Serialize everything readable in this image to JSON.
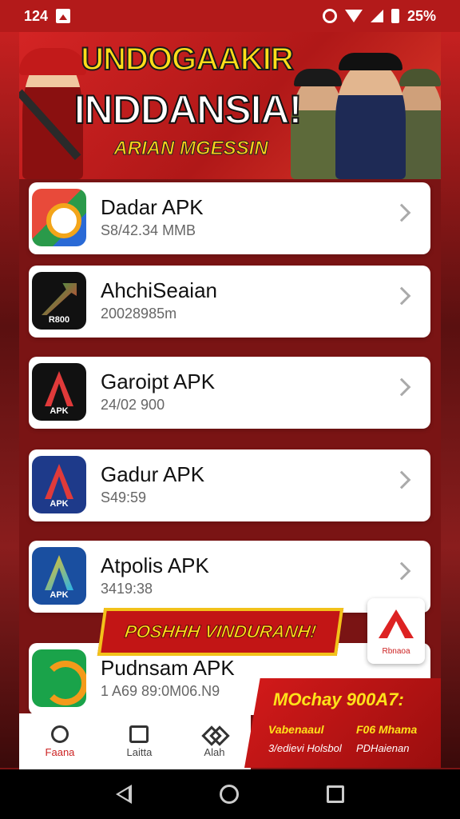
{
  "status_bar": {
    "time": "124",
    "battery": "25%"
  },
  "banner": {
    "title_line1": "UNDOGAAKIR",
    "title_line2": "INDDANSIA!",
    "subtitle": "ARIAN MGESSIN"
  },
  "apps": [
    {
      "name": "Dadar APK",
      "meta": "S8/42.34 MMB",
      "icon": "colorful-g-app-icon"
    },
    {
      "name": "AhchiSeaian",
      "meta": "20028985m",
      "icon": "red-arrow-app-icon",
      "icon_label": "R800"
    },
    {
      "name": "Garoipt APK",
      "meta": "24/02 900",
      "icon": "apk-a-black-icon",
      "icon_label": "APK"
    },
    {
      "name": "Gadur APK",
      "meta": "S49:59",
      "icon": "apk-a-blue-icon",
      "icon_label": "APK"
    },
    {
      "name": "Atpolis APK",
      "meta": "3419:38",
      "icon": "apk-a-yellow-icon",
      "icon_label": "APK"
    },
    {
      "name": "Pudnsam APK",
      "meta": "1 A69 89:0M06.N9",
      "icon": "green-arc-app-icon"
    }
  ],
  "promo_ribbon": "POSHHH VINDURANH!",
  "side_app": {
    "label": "Rbnaoa"
  },
  "tabs": [
    {
      "label": "Faana",
      "icon": "search-icon",
      "active": true
    },
    {
      "label": "Laitta",
      "icon": "apps-icon",
      "active": false
    },
    {
      "label": "Alah",
      "icon": "puzzle-icon",
      "active": false
    }
  ],
  "bottom_promo": {
    "title": "MOchay 900A7:",
    "line_a1": "Vabenaaul",
    "line_a2": "F06 Mhama",
    "line_b1": "3/edievi Holsbol",
    "line_b2": "PDHaienan"
  },
  "colors": {
    "accent": "#c21a1a",
    "banner_yellow": "#ffde1a"
  }
}
